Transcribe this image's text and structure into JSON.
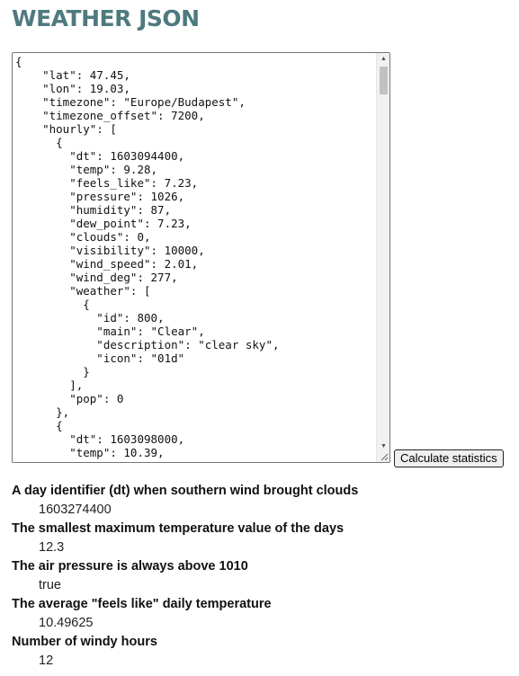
{
  "page": {
    "title": "WEATHER JSON"
  },
  "json_input": {
    "content": "{\n    \"lat\": 47.45,\n    \"lon\": 19.03,\n    \"timezone\": \"Europe/Budapest\",\n    \"timezone_offset\": 7200,\n    \"hourly\": [\n      {\n        \"dt\": 1603094400,\n        \"temp\": 9.28,\n        \"feels_like\": 7.23,\n        \"pressure\": 1026,\n        \"humidity\": 87,\n        \"dew_point\": 7.23,\n        \"clouds\": 0,\n        \"visibility\": 10000,\n        \"wind_speed\": 2.01,\n        \"wind_deg\": 277,\n        \"weather\": [\n          {\n            \"id\": 800,\n            \"main\": \"Clear\",\n            \"description\": \"clear sky\",\n            \"icon\": \"01d\"\n          }\n        ],\n        \"pop\": 0\n      },\n      {\n        \"dt\": 1603098000,\n        \"temp\": 10.39,"
  },
  "button": {
    "calculate_label": "Calculate statistics"
  },
  "stats": [
    {
      "label": "A day identifier (dt) when southern wind brought clouds",
      "value": "1603274400"
    },
    {
      "label": "The smallest maximum temperature value of the days",
      "value": "12.3"
    },
    {
      "label": "The air pressure is always above 1010",
      "value": "true"
    },
    {
      "label": "The average \"feels like\" daily temperature",
      "value": "10.49625"
    },
    {
      "label": "Number of windy hours",
      "value": "12"
    }
  ],
  "icons": {
    "scroll_up": "arrow-up-icon",
    "scroll_down": "arrow-down-icon",
    "resize": "resize-grip-icon"
  },
  "colors": {
    "title": "#4e7a7e",
    "button_bg": "#efefef",
    "scrollbar_track": "#f1f1f1",
    "scrollbar_thumb": "#c1c1c1"
  }
}
